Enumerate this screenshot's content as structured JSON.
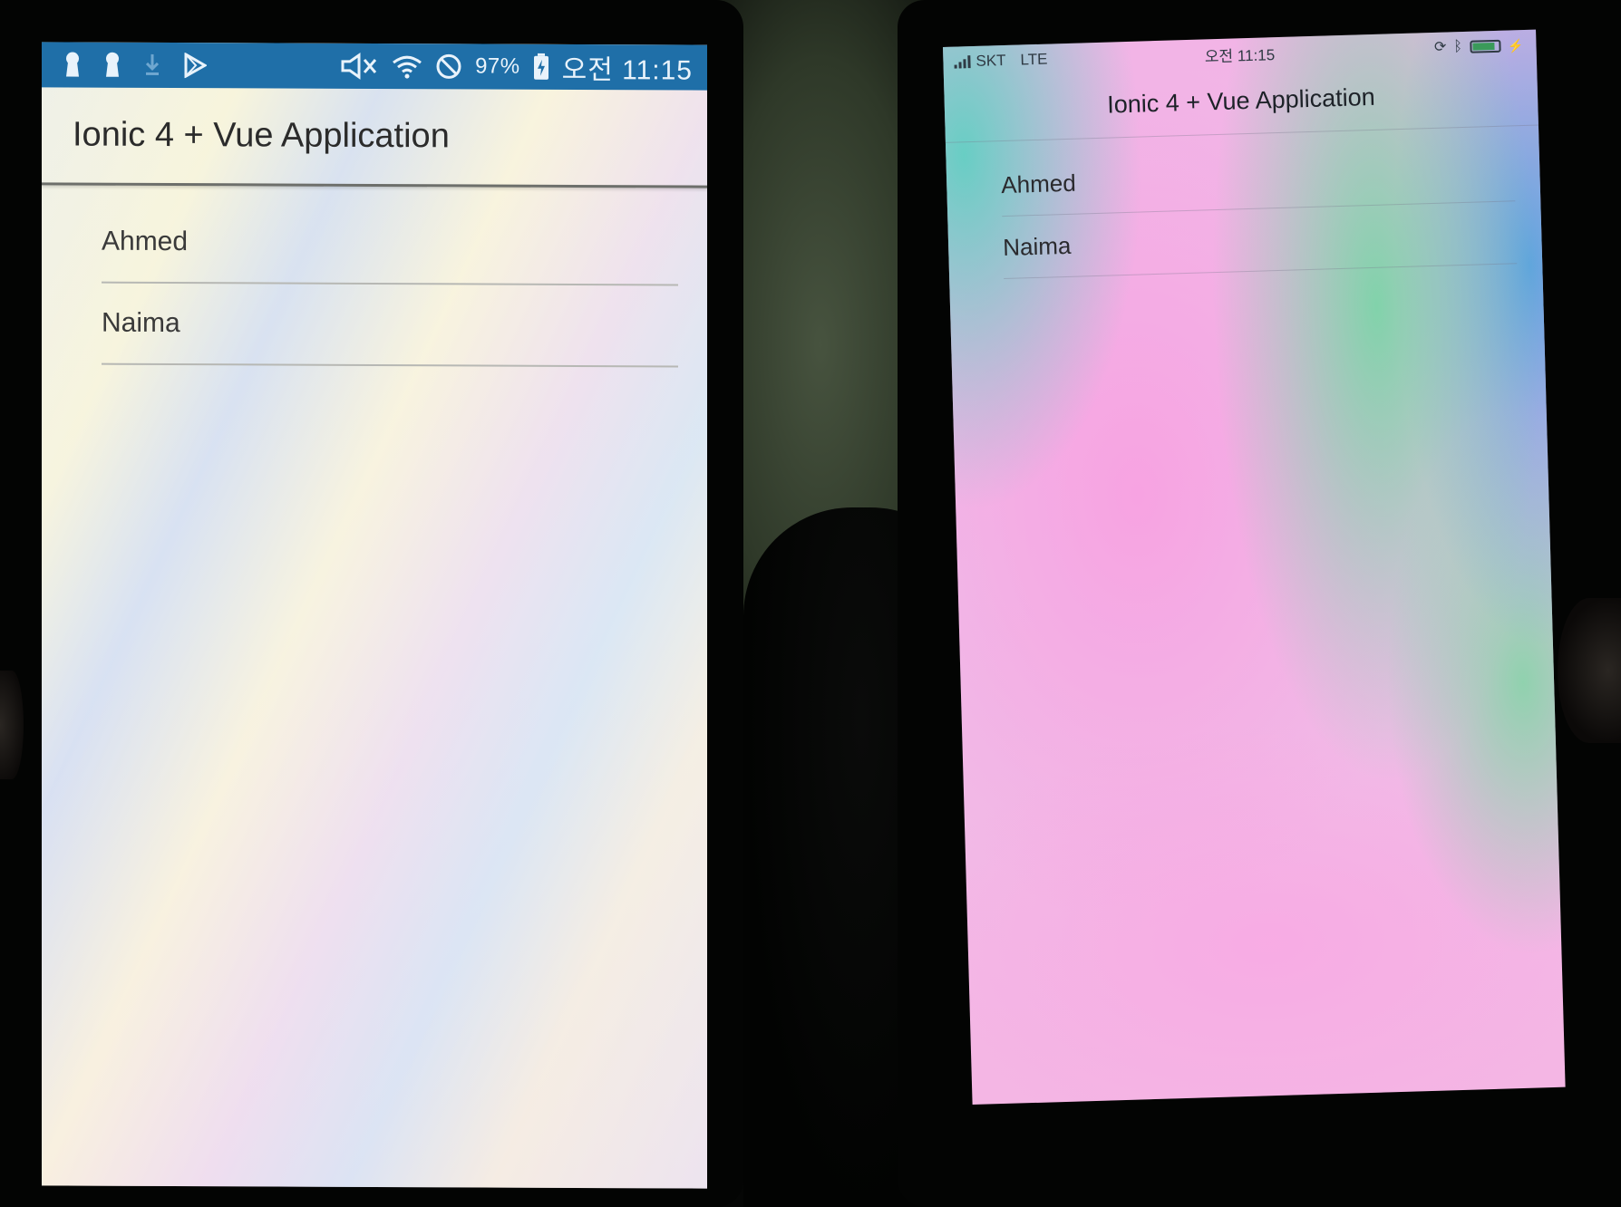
{
  "android": {
    "status_bar": {
      "icons_left": [
        "keyhole-icon",
        "keyhole-icon",
        "download-icon",
        "play-store-icon"
      ],
      "battery_percent": "97%",
      "time": "오전 11:15",
      "background": "#1f6fa8"
    },
    "toolbar": {
      "title": "Ionic 4 + Vue Application"
    },
    "list": {
      "items": [
        {
          "label": "Ahmed"
        },
        {
          "label": "Naima"
        }
      ]
    }
  },
  "ios": {
    "status_bar": {
      "carrier": "SKT",
      "network": "LTE",
      "time": "오전 11:15"
    },
    "toolbar": {
      "title": "Ionic 4 + Vue Application"
    },
    "list": {
      "items": [
        {
          "label": "Ahmed"
        },
        {
          "label": "Naima"
        }
      ]
    }
  }
}
